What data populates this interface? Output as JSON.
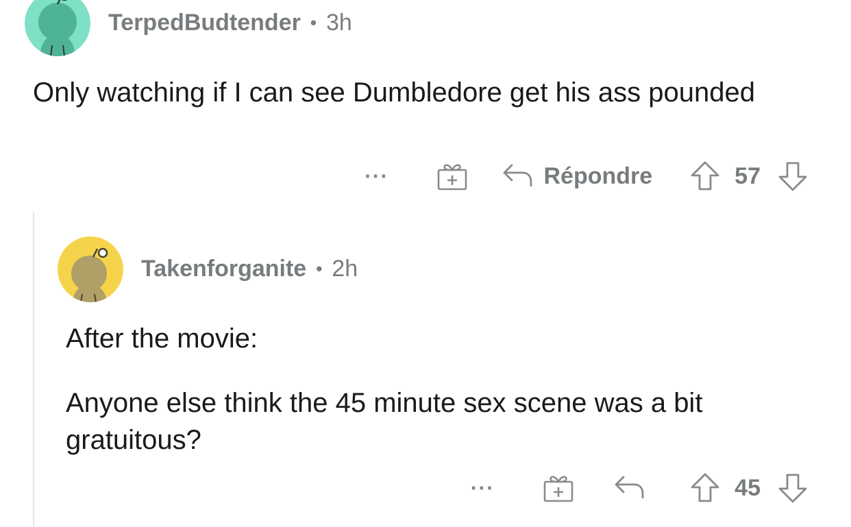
{
  "comments": [
    {
      "username": "TerpedBudtender",
      "separator": "•",
      "time": "3h",
      "avatar_color": "#7ee0c5",
      "avatar_body_color": "#4fb397",
      "body": [
        "Only watching if I can see Dumbledore get his ass pounded"
      ],
      "actions": {
        "more_icon": "more-icon",
        "award_icon": "gift-icon",
        "reply_label": "Répondre",
        "upvote_icon": "arrow-up-icon",
        "score": "57",
        "downvote_icon": "arrow-down-icon"
      }
    },
    {
      "username": "Takenforganite",
      "separator": "•",
      "time": "2h",
      "avatar_color": "#f5d44b",
      "avatar_body_color": "#b09f66",
      "body": [
        "After the movie:",
        "Anyone else think the 45 minute sex scene was a bit gratuitous?"
      ],
      "actions": {
        "more_icon": "more-icon",
        "award_icon": "gift-icon",
        "reply_label": "",
        "upvote_icon": "arrow-up-icon",
        "score": "45",
        "downvote_icon": "arrow-down-icon"
      }
    }
  ],
  "colors": {
    "meta_text": "#787c7e",
    "body_text": "#1a1a1b",
    "thread_line": "#e4e4e4"
  }
}
